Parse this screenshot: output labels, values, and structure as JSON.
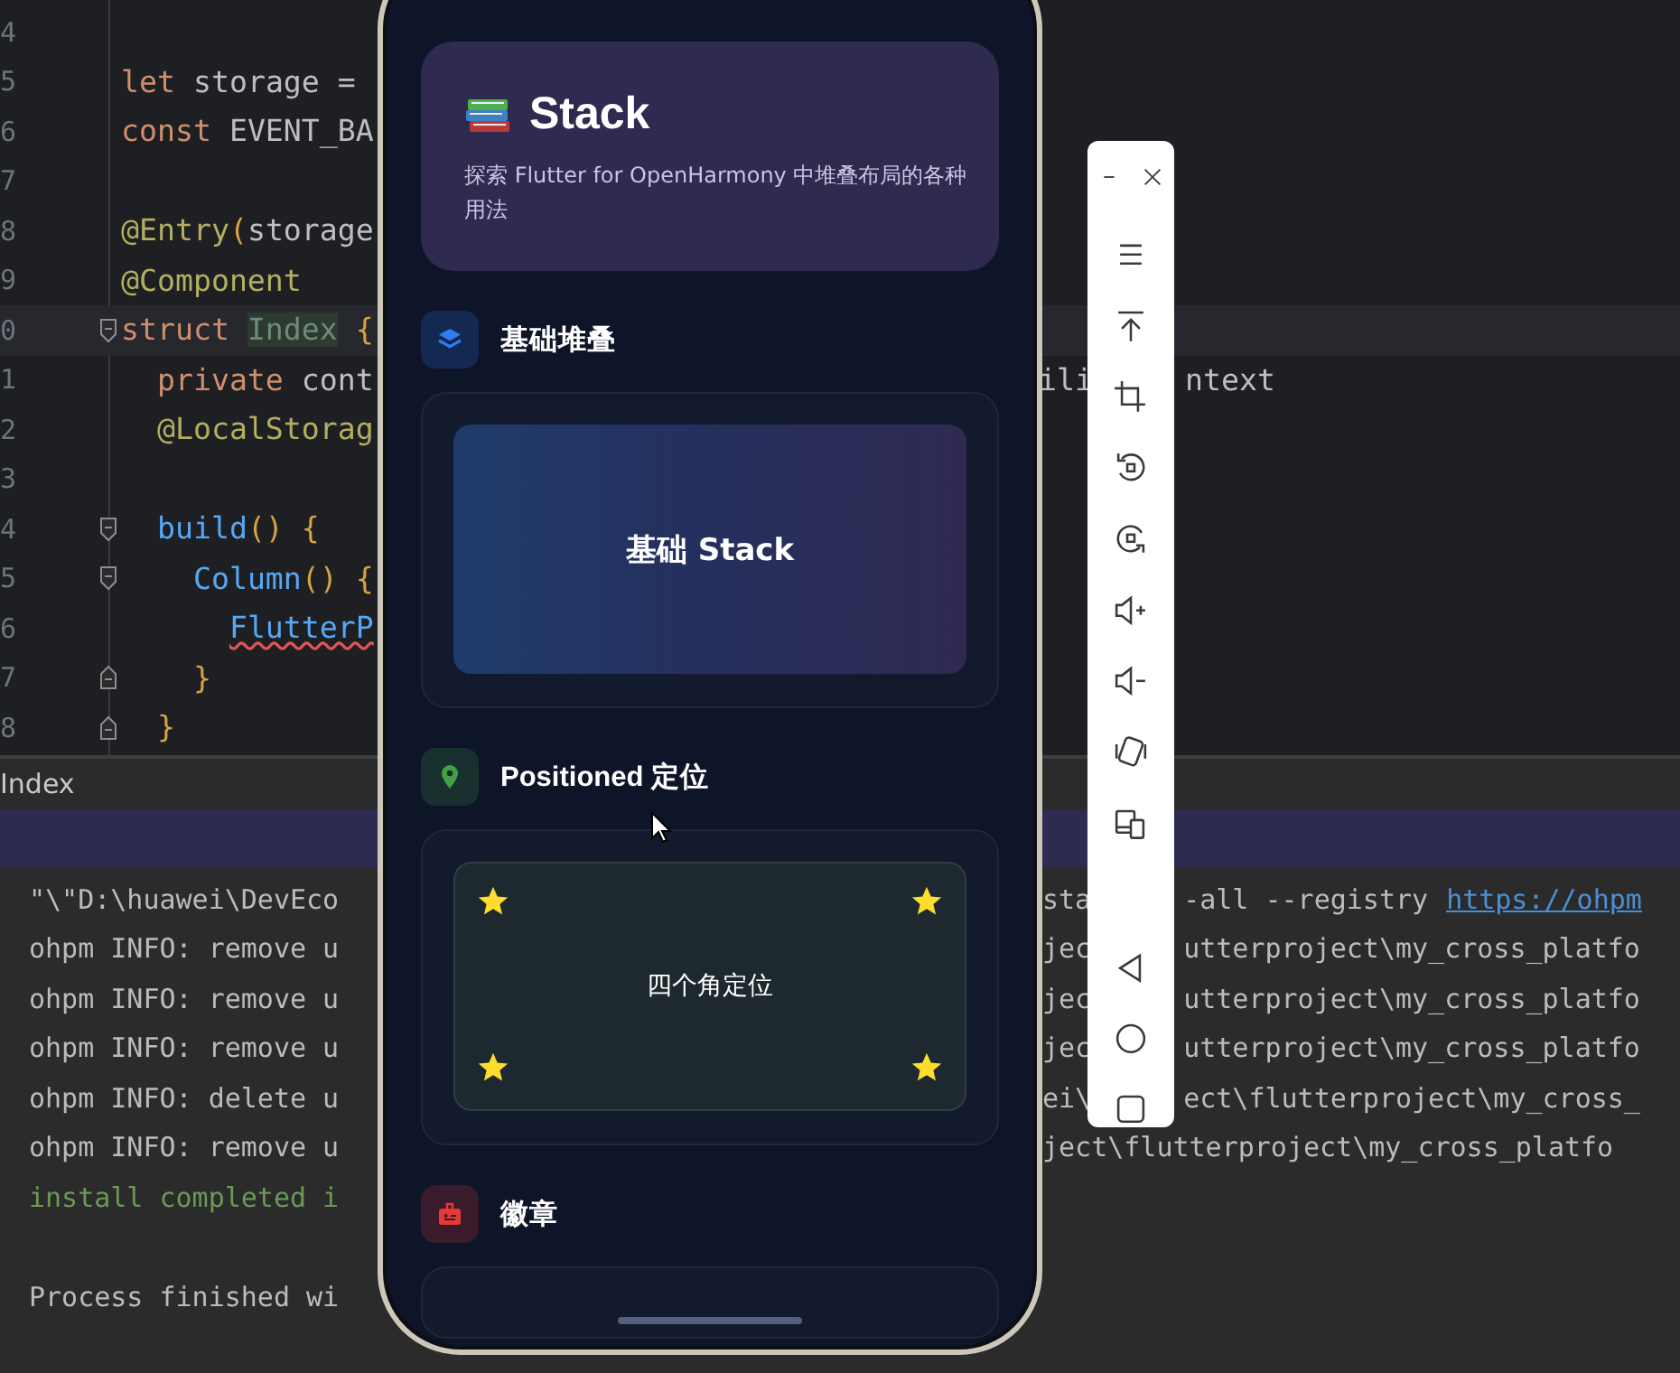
{
  "editor": {
    "lines": [
      {
        "number": "4",
        "kind": "code",
        "current": false
      },
      {
        "number": "5",
        "kind": "code",
        "current": false,
        "code": [
          {
            "text": "let",
            "kind": "keyword"
          },
          {
            "text": " storage =",
            "kind": "plain"
          }
        ]
      },
      {
        "number": "6",
        "kind": "code",
        "current": false,
        "code": [
          {
            "text": "const",
            "kind": "keyword"
          },
          {
            "text": " EVENT_BA",
            "kind": "plain"
          }
        ]
      },
      {
        "number": "7",
        "kind": "code",
        "current": false
      },
      {
        "number": "8",
        "kind": "code",
        "current": false,
        "code": [
          {
            "text": "@Entry",
            "kind": "annotation"
          },
          {
            "text": "(",
            "kind": "brace"
          },
          {
            "text": "storage",
            "kind": "plain"
          }
        ]
      },
      {
        "number": "9",
        "kind": "code",
        "current": false,
        "code": [
          {
            "text": "@Component",
            "kind": "annotation"
          }
        ]
      },
      {
        "number": "0",
        "kind": "fold_open",
        "current": true,
        "code": [
          {
            "text": "struct ",
            "kind": "keyword"
          },
          {
            "text": "Index",
            "kind": "unused"
          },
          {
            "text": " {",
            "kind": "brace"
          }
        ]
      },
      {
        "number": "1",
        "kind": "code",
        "current": false,
        "code": [
          {
            "text": "  private",
            "kind": "keyword"
          },
          {
            "text": " cont",
            "kind": "plain"
          }
        ],
        "right": [
          [
            "ili"
          ],
          [
            "ntext"
          ]
        ]
      },
      {
        "number": "2",
        "kind": "code",
        "current": false,
        "code": [
          {
            "text": "  @LocalStorag",
            "kind": "annotation"
          }
        ]
      },
      {
        "number": "3",
        "kind": "code",
        "current": false
      },
      {
        "number": "4",
        "kind": "fold_open",
        "current": false,
        "code": [
          {
            "text": "  build",
            "kind": "func"
          },
          {
            "text": "()",
            "kind": "brace"
          },
          {
            "text": " {",
            "kind": "brace"
          }
        ]
      },
      {
        "number": "5",
        "kind": "fold_open",
        "current": false,
        "code": [
          {
            "text": "    Column",
            "kind": "func"
          },
          {
            "text": "()",
            "kind": "brace"
          },
          {
            "text": " {",
            "kind": "brace"
          }
        ]
      },
      {
        "number": "6",
        "kind": "code",
        "current": false,
        "code": [
          {
            "text": "      FlutterP",
            "kind": "error"
          }
        ]
      },
      {
        "number": "7",
        "kind": "fold_close",
        "current": false,
        "code": [
          {
            "text": "    }",
            "kind": "brace"
          }
        ]
      },
      {
        "number": "8",
        "kind": "fold_close",
        "current": false,
        "code": [
          {
            "text": "  }",
            "kind": "brace"
          }
        ]
      }
    ]
  },
  "console": {
    "tab": "Index",
    "lines": [
      {
        "text": "\"\\\"D:\\huawei\\DevEco",
        "kind": "plain",
        "right": [
          [
            {
              "text": "sta",
              "kind": "plain"
            }
          ],
          [
            {
              "text": "-all --registry",
              "kind": "plain"
            },
            {
              "text": "https://ohpm",
              "kind": "link"
            }
          ]
        ]
      },
      {
        "text": "ohpm INFO: remove u",
        "kind": "plain",
        "right": [
          [
            {
              "text": "jec",
              "kind": "plain"
            }
          ],
          [
            {
              "text": "utterproject\\my_cross_platfo",
              "kind": "plain"
            }
          ]
        ]
      },
      {
        "text": "ohpm INFO: remove u",
        "kind": "plain",
        "right": [
          [
            {
              "text": "jec",
              "kind": "plain"
            }
          ],
          [
            {
              "text": "utterproject\\my_cross_platfo",
              "kind": "plain"
            }
          ]
        ]
      },
      {
        "text": "ohpm INFO: remove u",
        "kind": "plain",
        "right": [
          [
            {
              "text": "jec",
              "kind": "plain"
            }
          ],
          [
            {
              "text": "utterproject\\my_cross_platfo",
              "kind": "plain"
            }
          ]
        ]
      },
      {
        "text": "ohpm INFO: delete u",
        "kind": "plain",
        "right": [
          [
            {
              "text": "ei\\",
              "kind": "plain"
            }
          ],
          [
            {
              "text": "ect\\flutterproject\\my_cross_",
              "kind": "plain"
            }
          ]
        ]
      },
      {
        "text": "ohpm INFO: remove u",
        "kind": "plain",
        "right": [
          [
            {
              "text": "ject\\flutterproject\\my_cross_platfo",
              "kind": "plain"
            }
          ]
        ]
      },
      {
        "text": "install completed i",
        "kind": "success"
      },
      {
        "kind": "blank"
      },
      {
        "text": "Process finished wi",
        "kind": "plain"
      }
    ]
  },
  "phone": {
    "header": {
      "title": "Stack",
      "description": "探索 Flutter for OpenHarmony 中堆叠布局的各种用法"
    },
    "sections": [
      {
        "title": "基础堆叠",
        "color": "#2f7cf6",
        "demo": {
          "kind": "gradient",
          "label": "基础 Stack"
        }
      },
      {
        "title": "Positioned 定位",
        "color": "#43a047",
        "demo": {
          "kind": "corners",
          "label": "四个角定位"
        }
      },
      {
        "title": "徽章",
        "color": "#e53935",
        "demo": {
          "kind": "partial"
        }
      }
    ]
  }
}
